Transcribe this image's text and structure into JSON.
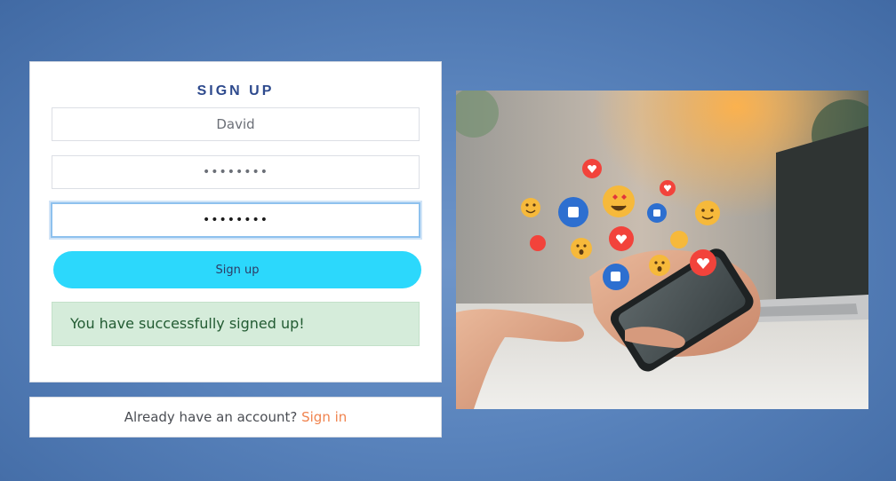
{
  "signup": {
    "title": "SIGN UP",
    "username_value": "David",
    "password_masked": "••••••••",
    "confirm_password_masked": "••••••••",
    "button_label": "Sign up",
    "success_message": "You have successfully signed up!"
  },
  "signin": {
    "prompt": "Already have an account?",
    "link_label": "Sign in"
  },
  "image": {
    "description_icon": "phone-social-reactions-illustration"
  },
  "colors": {
    "accent_button": "#2cd8fc",
    "title_blue": "#2e4a8d",
    "link_orange": "#f0834e",
    "success_bg": "#d5ecda",
    "success_text": "#225b32"
  }
}
